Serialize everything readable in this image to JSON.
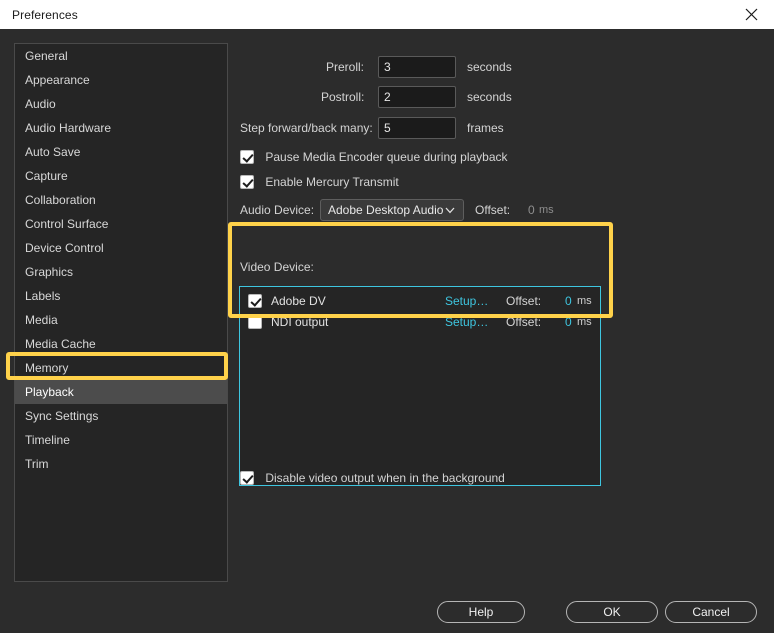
{
  "window": {
    "title": "Preferences",
    "close_icon": "close-icon"
  },
  "sidebar": {
    "items": [
      {
        "label": "General",
        "selected": false
      },
      {
        "label": "Appearance",
        "selected": false
      },
      {
        "label": "Audio",
        "selected": false
      },
      {
        "label": "Audio Hardware",
        "selected": false
      },
      {
        "label": "Auto Save",
        "selected": false
      },
      {
        "label": "Capture",
        "selected": false
      },
      {
        "label": "Collaboration",
        "selected": false
      },
      {
        "label": "Control Surface",
        "selected": false
      },
      {
        "label": "Device Control",
        "selected": false
      },
      {
        "label": "Graphics",
        "selected": false
      },
      {
        "label": "Labels",
        "selected": false
      },
      {
        "label": "Media",
        "selected": false
      },
      {
        "label": "Media Cache",
        "selected": false
      },
      {
        "label": "Memory",
        "selected": false
      },
      {
        "label": "Playback",
        "selected": true
      },
      {
        "label": "Sync Settings",
        "selected": false
      },
      {
        "label": "Timeline",
        "selected": false
      },
      {
        "label": "Trim",
        "selected": false
      }
    ]
  },
  "playback": {
    "preroll": {
      "label": "Preroll:",
      "value": "3",
      "unit": "seconds"
    },
    "postroll": {
      "label": "Postroll:",
      "value": "2",
      "unit": "seconds"
    },
    "step": {
      "label": "Step forward/back many:",
      "value": "5",
      "unit": "frames"
    },
    "pause_media_encoder": {
      "label": "Pause Media Encoder queue during playback",
      "checked": true
    },
    "enable_mercury_transmit": {
      "label": "Enable Mercury Transmit",
      "checked": true
    },
    "audio_device": {
      "label": "Audio Device:",
      "value": "Adobe Desktop Audio",
      "chevron": "chevron-down-icon",
      "offset_label": "Offset:",
      "offset_value": "0",
      "offset_unit": "ms"
    },
    "video_device": {
      "label": "Video Device:",
      "devices": [
        {
          "name": "Adobe DV",
          "checked": true,
          "setup_label": "Setup…",
          "offset_label": "Offset:",
          "offset_value": "0",
          "offset_unit": "ms"
        },
        {
          "name": "NDI output",
          "checked": false,
          "setup_label": "Setup…",
          "offset_label": "Offset:",
          "offset_value": "0",
          "offset_unit": "ms"
        }
      ]
    },
    "disable_video_output": {
      "label": "Disable video output when in the background",
      "checked": true
    }
  },
  "footer": {
    "help": "Help",
    "ok": "OK",
    "cancel": "Cancel"
  },
  "colors": {
    "accent_cyan": "#3ec6e0",
    "annotation_yellow": "#ffd24a",
    "selected_row": "#4c4c4c"
  }
}
